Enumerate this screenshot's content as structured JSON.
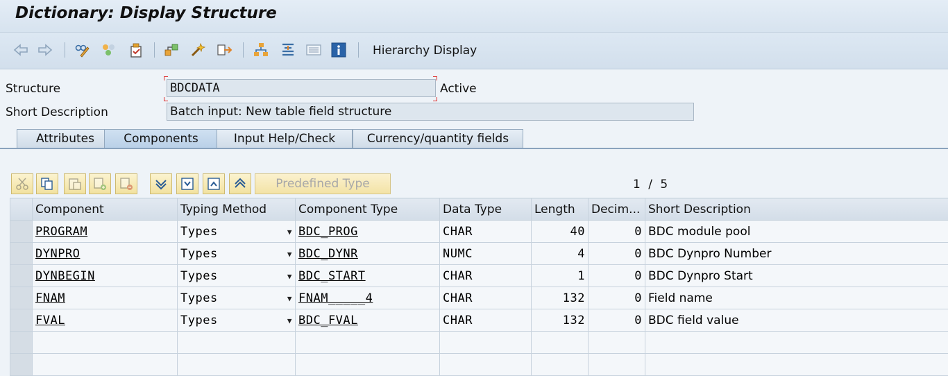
{
  "title": "Dictionary: Display Structure",
  "toolbar": {
    "hierarchy_display": "Hierarchy Display",
    "icons": [
      "back-icon",
      "forward-icon",
      "display-change-icon",
      "other-object-icon",
      "check-icon",
      "activate-icon",
      "where-used-icon",
      "object-list-icon",
      "hierarchy-icon",
      "append-structure-icon",
      "navigation-window-icon",
      "info-icon"
    ]
  },
  "form": {
    "structure_label": "Structure",
    "structure_value": "BDCDATA",
    "status": "Active",
    "short_desc_label": "Short Description",
    "short_desc_value": "Batch input: New table field structure"
  },
  "tabs": [
    {
      "label": "Attributes",
      "active": false
    },
    {
      "label": "Components",
      "active": true
    },
    {
      "label": "Input Help/Check",
      "active": false
    },
    {
      "label": "Currency/quantity fields",
      "active": false
    }
  ],
  "grid_toolbar": {
    "predefined_type": "Predefined Type",
    "pager_current": "1",
    "pager_sep": "/",
    "pager_total": "5"
  },
  "table": {
    "headers": [
      "Component",
      "Typing Method",
      "Component Type",
      "Data Type",
      "Length",
      "Decim...",
      "Short Description"
    ],
    "rows": [
      {
        "component": "PROGRAM",
        "typing": "Types",
        "comp_type": "BDC_PROG",
        "data_type": "CHAR",
        "length": "40",
        "decimals": "0",
        "desc": "BDC module pool"
      },
      {
        "component": "DYNPRO",
        "typing": "Types",
        "comp_type": "BDC_DYNR",
        "data_type": "NUMC",
        "length": "4",
        "decimals": "0",
        "desc": "BDC Dynpro Number"
      },
      {
        "component": "DYNBEGIN",
        "typing": "Types",
        "comp_type": "BDC_START",
        "data_type": "CHAR",
        "length": "1",
        "decimals": "0",
        "desc": "BDC Dynpro Start"
      },
      {
        "component": "FNAM",
        "typing": "Types",
        "comp_type": "FNAM_____4",
        "data_type": "CHAR",
        "length": "132",
        "decimals": "0",
        "desc": "Field name"
      },
      {
        "component": "FVAL",
        "typing": "Types",
        "comp_type": "BDC_FVAL",
        "data_type": "CHAR",
        "length": "132",
        "decimals": "0",
        "desc": "BDC field value"
      }
    ]
  }
}
